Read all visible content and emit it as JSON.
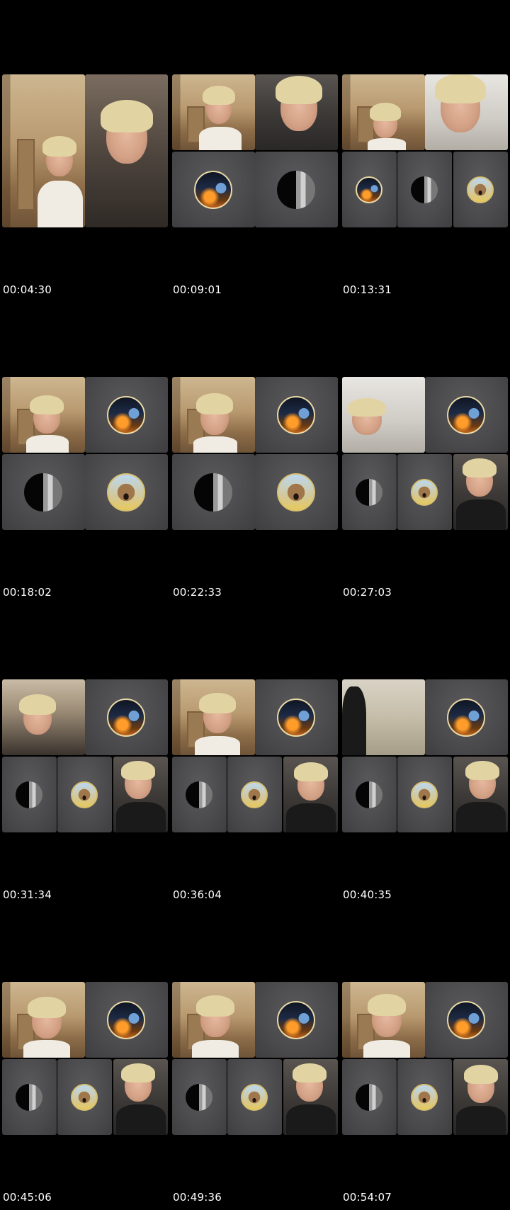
{
  "sheet": {
    "background_color": "#000000",
    "timestamp_color": "#ffffff",
    "thumbnails": [
      {
        "timestamp": "00:04:30"
      },
      {
        "timestamp": "00:09:01"
      },
      {
        "timestamp": "00:13:31"
      },
      {
        "timestamp": "00:18:02"
      },
      {
        "timestamp": "00:22:33"
      },
      {
        "timestamp": "00:27:03"
      },
      {
        "timestamp": "00:31:34"
      },
      {
        "timestamp": "00:36:04"
      },
      {
        "timestamp": "00:40:35"
      },
      {
        "timestamp": "00:45:06"
      },
      {
        "timestamp": "00:49:36"
      },
      {
        "timestamp": "00:54:07"
      }
    ]
  }
}
